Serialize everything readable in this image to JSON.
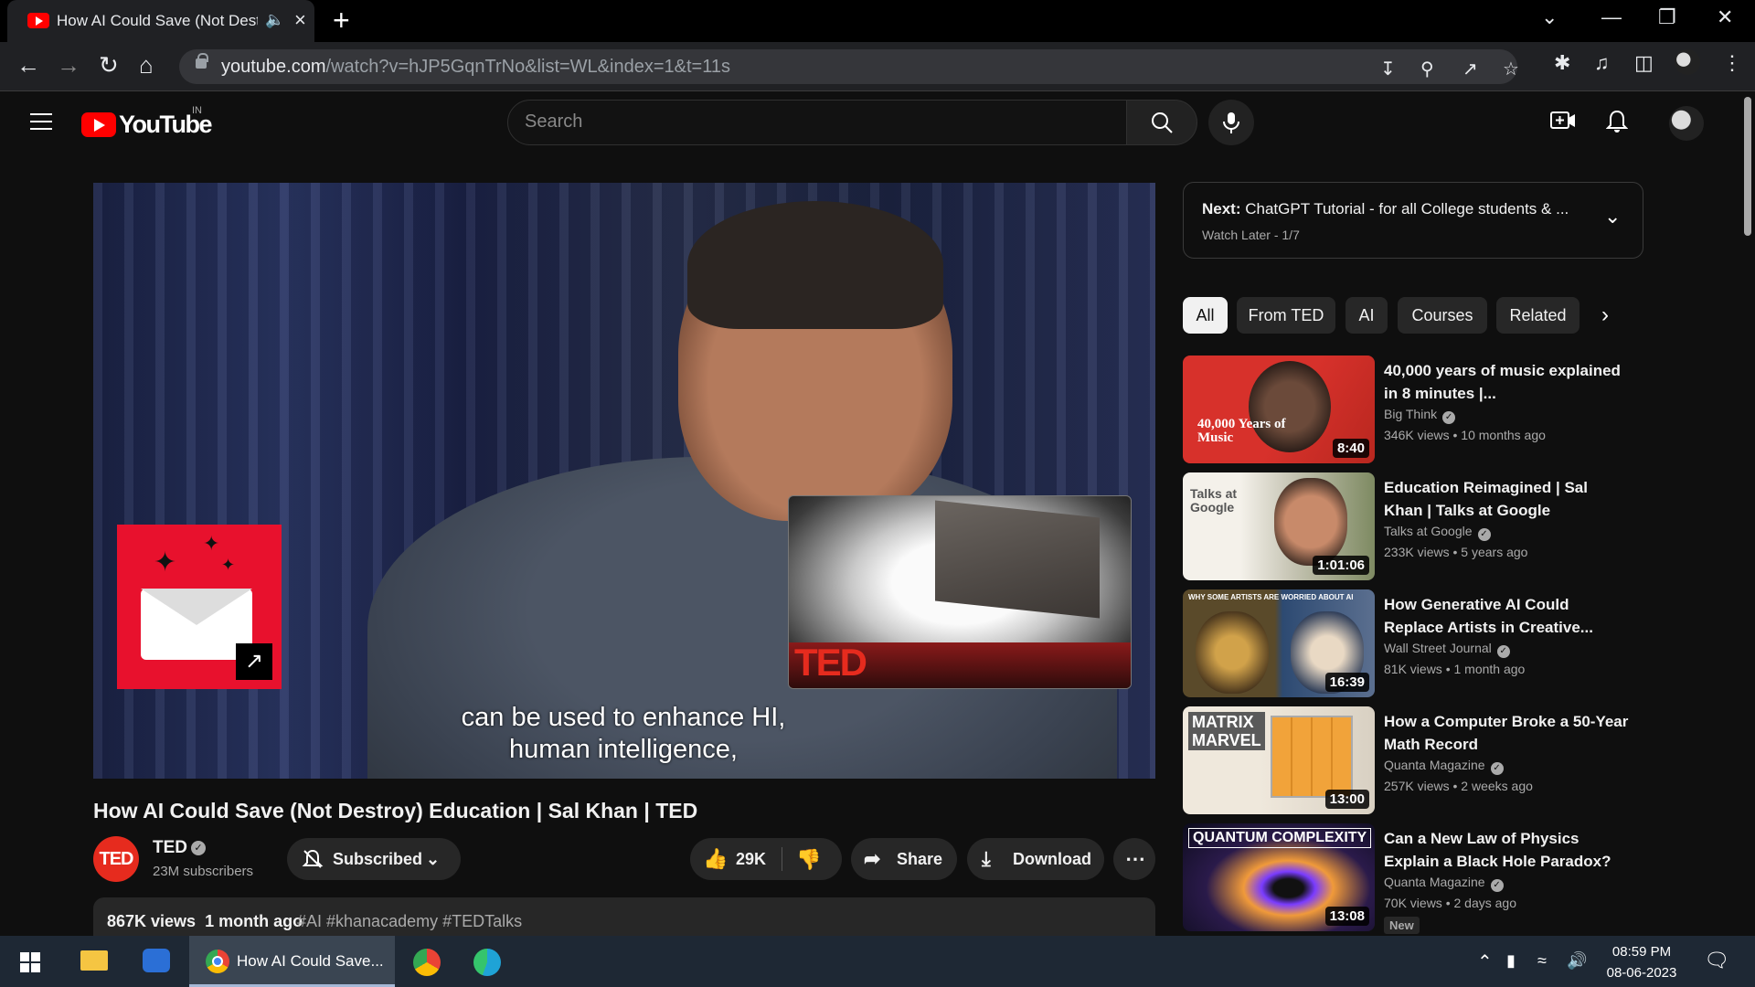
{
  "browser": {
    "tab_title": "How AI Could Save (Not Destroy) Education | Sal Khan | TED",
    "url_host": "youtube.com",
    "url_path": "/watch?v=hJP5GqnTrNo&list=WL&index=1&t=11s"
  },
  "youtube": {
    "logo_text": "YouTube",
    "country_code": "IN",
    "search_placeholder": "Search"
  },
  "video": {
    "caption_line1": "can be used to enhance HI,",
    "caption_line2": "human intelligence,",
    "endcard_logo": "TED",
    "title": "How AI Could Save (Not Destroy) Education | Sal Khan | TED",
    "channel_name": "TED",
    "channel_avatar_text": "TED",
    "subscribers": "23M subscribers",
    "subscribe_label": "Subscribed",
    "likes": "29K",
    "share_label": "Share",
    "download_label": "Download",
    "views": "867K views",
    "age": "1 month ago",
    "hashtags": "#AI #khanacademy #TEDTalks"
  },
  "next": {
    "prefix": "Next:",
    "title": "ChatGPT Tutorial - for all College students & ...",
    "playlist": "Watch Later - 1/7"
  },
  "chips": [
    "All",
    "From TED",
    "AI",
    "Courses",
    "Related"
  ],
  "recommendations": [
    {
      "title": "40,000 years of music explained in 8 minutes |...",
      "channel": "Big Think",
      "views": "346K views",
      "age": "10 months ago",
      "duration": "8:40",
      "thumb_text": "40,000 Years of Music",
      "badge": ""
    },
    {
      "title": "Education Reimagined | Sal Khan | Talks at Google",
      "channel": "Talks at Google",
      "views": "233K views",
      "age": "5 years ago",
      "duration": "1:01:06",
      "thumb_text": "Talks at Google",
      "badge": ""
    },
    {
      "title": "How Generative AI Could Replace Artists in Creative...",
      "channel": "Wall Street Journal",
      "views": "81K views",
      "age": "1 month ago",
      "duration": "16:39",
      "thumb_text": "WHY SOME ARTISTS ARE WORRIED ABOUT AI",
      "badge": ""
    },
    {
      "title": "How a Computer Broke a 50-Year Math Record",
      "channel": "Quanta Magazine",
      "views": "257K views",
      "age": "2 weeks ago",
      "duration": "13:00",
      "thumb_text": "MATRIX MARVEL",
      "badge": ""
    },
    {
      "title": "Can a New Law of Physics Explain a Black Hole Paradox?",
      "channel": "Quanta Magazine",
      "views": "70K views",
      "age": "2 days ago",
      "duration": "13:08",
      "thumb_text": "QUANTUM COMPLEXITY",
      "badge": "New"
    }
  ],
  "taskbar": {
    "active_task_label": "How AI Could Save...",
    "time": "08:59 PM",
    "date": "08-06-2023"
  },
  "colors": {
    "youtube_red": "#ff0000",
    "ted_red": "#e62b1e",
    "background": "#0f0f0f"
  }
}
